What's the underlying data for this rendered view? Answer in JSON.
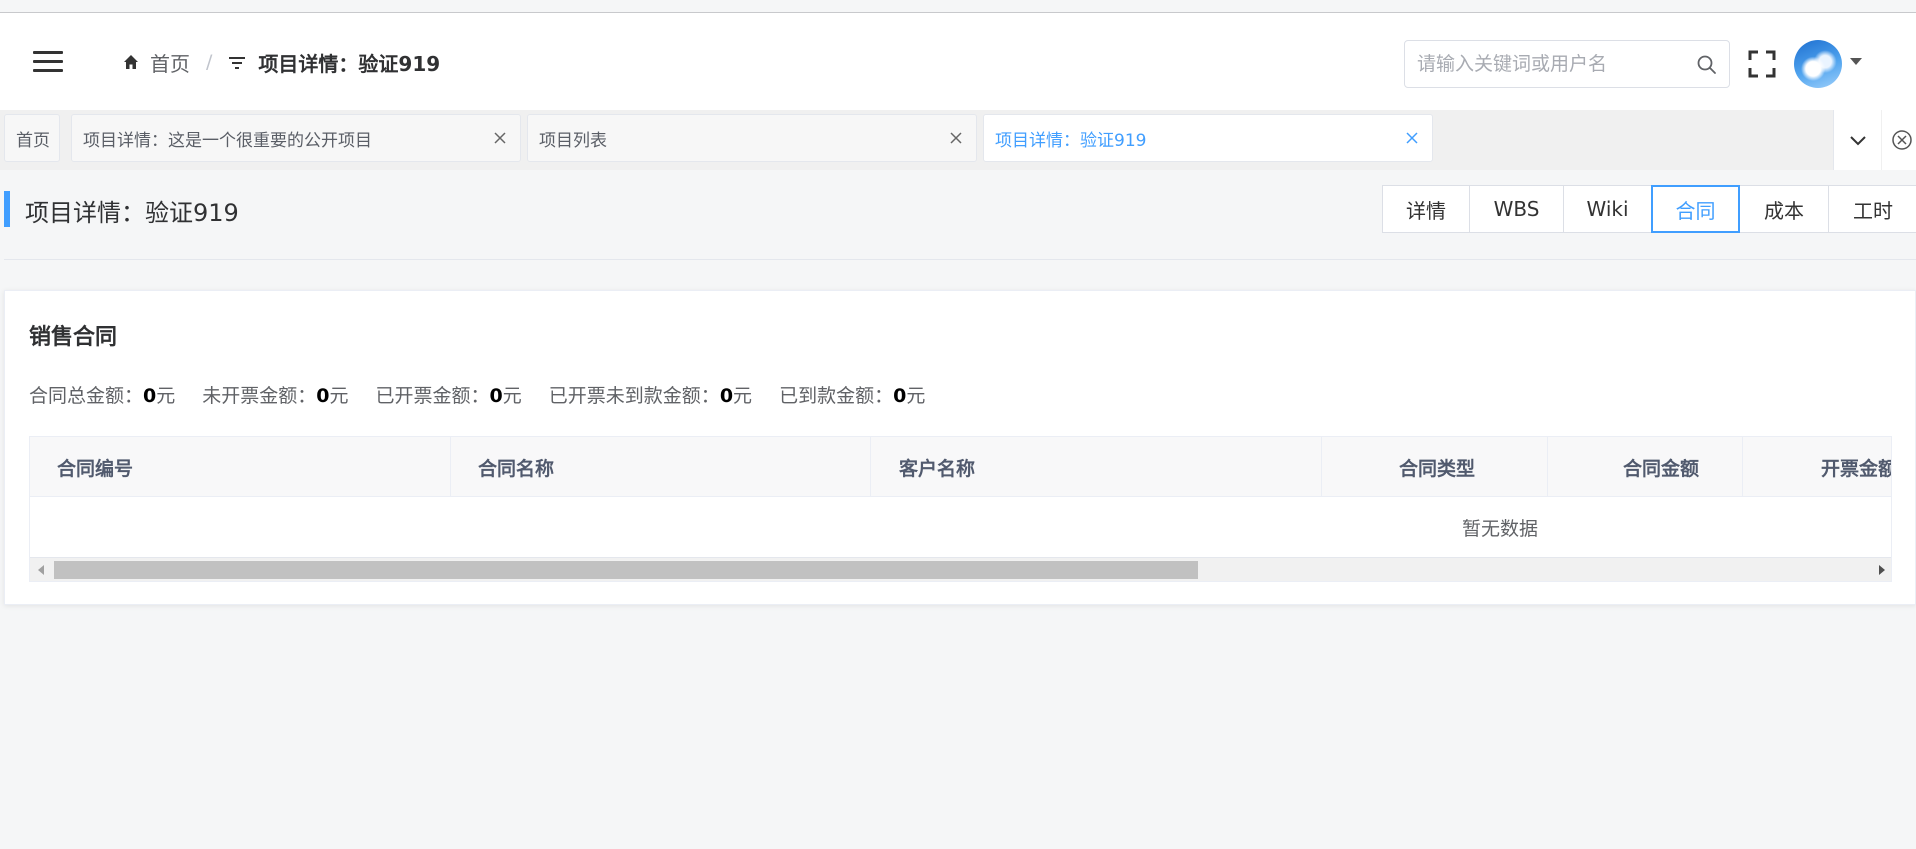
{
  "header": {
    "breadcrumb": {
      "home_label": "首页",
      "separator": "/",
      "current_label": "项目详情：验证919"
    },
    "search": {
      "placeholder": "请输入关键词或用户名",
      "value": ""
    }
  },
  "tags": [
    {
      "label": "首页",
      "active": false,
      "closable": false
    },
    {
      "label": "项目详情：这是一个很重要的公开项目",
      "active": false,
      "closable": true
    },
    {
      "label": "项目列表",
      "active": false,
      "closable": true
    },
    {
      "label": "项目详情：验证919",
      "active": true,
      "closable": true
    }
  ],
  "page": {
    "title": "项目详情：验证919",
    "tabs": [
      {
        "label": "详情",
        "active": false
      },
      {
        "label": "WBS",
        "active": false
      },
      {
        "label": "Wiki",
        "active": false
      },
      {
        "label": "合同",
        "active": true
      },
      {
        "label": "成本",
        "active": false
      },
      {
        "label": "工时",
        "active": false
      }
    ]
  },
  "contracts": {
    "title": "销售合同",
    "summary": [
      {
        "label": "合同总金额：",
        "value": "0",
        "unit": "元"
      },
      {
        "label": "未开票金额：",
        "value": "0",
        "unit": "元"
      },
      {
        "label": "已开票金额：",
        "value": "0",
        "unit": "元"
      },
      {
        "label": "已开票未到款金额：",
        "value": "0",
        "unit": "元"
      },
      {
        "label": "已到款金额：",
        "value": "0",
        "unit": "元"
      }
    ],
    "columns": [
      "合同编号",
      "合同名称",
      "客户名称",
      "合同类型",
      "合同金额",
      "开票金额"
    ],
    "empty_text": "暂无数据"
  },
  "colors": {
    "accent": "#409eff",
    "title_bar": "#409eff"
  }
}
